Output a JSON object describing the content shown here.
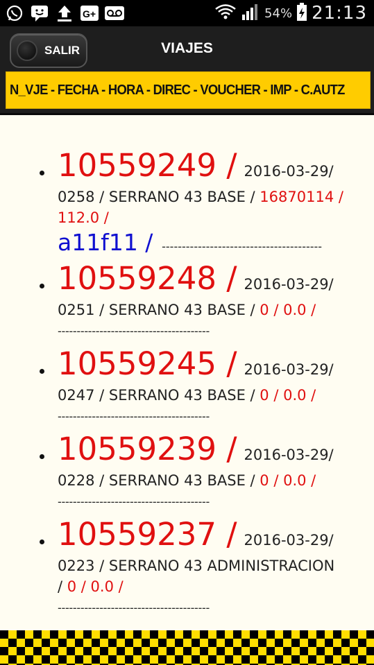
{
  "status_bar": {
    "icons_left": [
      "whatsapp-icon",
      "chat-icon",
      "upload-icon",
      "google-plus-icon",
      "voicemail-icon"
    ],
    "battery_percent": "54%",
    "time": "21:13"
  },
  "header": {
    "exit_label": "SALIR",
    "title": "VIAJES",
    "columns": "N_VJE - FECHA - HORA - DIREC - VOUCHER - IMP - C.AUTZ"
  },
  "trips": [
    {
      "id": "10559249 /",
      "date": "2016-03-29/",
      "detail": "0258 / SERRANO 43 BASE /",
      "voucher": "16870114 /",
      "amount": "112.0 /",
      "auth": "a11f11 /",
      "dashes": "----------------------------------------"
    },
    {
      "id": "10559248 /",
      "date": "2016-03-29/",
      "detail": "0251 / SERRANO 43 BASE /",
      "voucher_amount": "0 / 0.0 /",
      "dashes": "----------------------------------------"
    },
    {
      "id": "10559245 /",
      "date": "2016-03-29/",
      "detail": "0247 / SERRANO 43 BASE /",
      "voucher_amount": "0 / 0.0 /",
      "dashes": "----------------------------------------"
    },
    {
      "id": "10559239 /",
      "date": "2016-03-29/",
      "detail": "0228 / SERRANO 43 BASE /",
      "voucher_amount": "0 / 0.0 /",
      "dashes": "----------------------------------------"
    },
    {
      "id": "10559237 /",
      "date": "2016-03-29/",
      "detail": "0223 / SERRANO 43 ADMINISTRACION",
      "detail2": "/",
      "voucher_amount": "0 / 0.0 /",
      "dashes": "----------------------------------------"
    }
  ]
}
